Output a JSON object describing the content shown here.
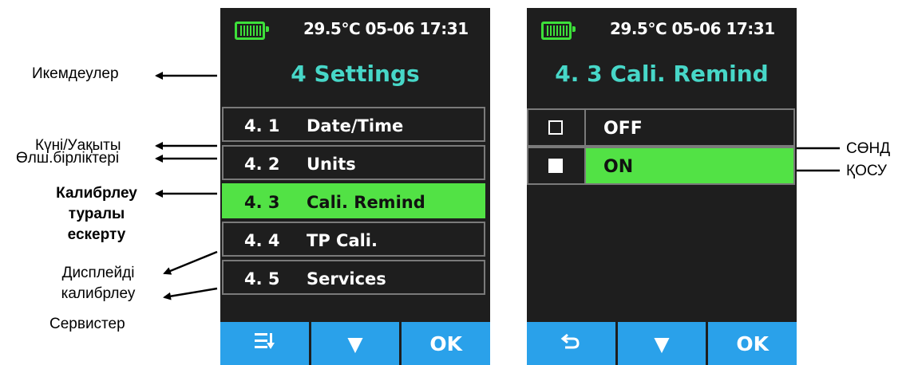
{
  "status_bar": {
    "text": "29.5℃ 05-06 17:31"
  },
  "left_screen": {
    "title": "4 Settings",
    "menu": [
      {
        "number": "4. 1",
        "label": "Date/Time"
      },
      {
        "number": "4. 2",
        "label": "Units"
      },
      {
        "number": "4. 3",
        "label": "Cali. Remind",
        "selected": true
      },
      {
        "number": "4. 4",
        "label": "TP Cali."
      },
      {
        "number": "4. 5",
        "label": "Services"
      }
    ],
    "softkeys": [
      {
        "icon": "menu-sort-icon",
        "glyph": "☰"
      },
      {
        "icon": "down-triangle-icon",
        "glyph": "▼"
      },
      {
        "label": "OK"
      }
    ]
  },
  "right_screen": {
    "title": "4. 3 Cali. Remind",
    "options": [
      {
        "label": "OFF",
        "checked": false
      },
      {
        "label": "ON",
        "checked": true,
        "highlighted": true
      }
    ],
    "softkeys": [
      {
        "icon": "back-arrow-icon",
        "glyph": "↶"
      },
      {
        "icon": "down-triangle-icon",
        "glyph": "▼"
      },
      {
        "label": "OK"
      }
    ]
  },
  "callouts_left": {
    "settings": "Икемдеулер",
    "date_time": "Күні/Уақыты",
    "units": "Өлш.бірліктері",
    "cali_remind_1": "Калибрлеу",
    "cali_remind_2": "туралы",
    "cali_remind_3": "ескерту",
    "tp_cali_1": "Дисплейді",
    "tp_cali_2": "калибрлеу",
    "services": "Сервистер"
  },
  "callouts_right": {
    "off": "СӨНД",
    "on": "ҚОСУ"
  },
  "colors": {
    "screen_bg": "#1e1e1e",
    "title": "#47d7c8",
    "selected": "#52e245",
    "softkey": "#2aa1ea",
    "battery": "#3de03a"
  }
}
